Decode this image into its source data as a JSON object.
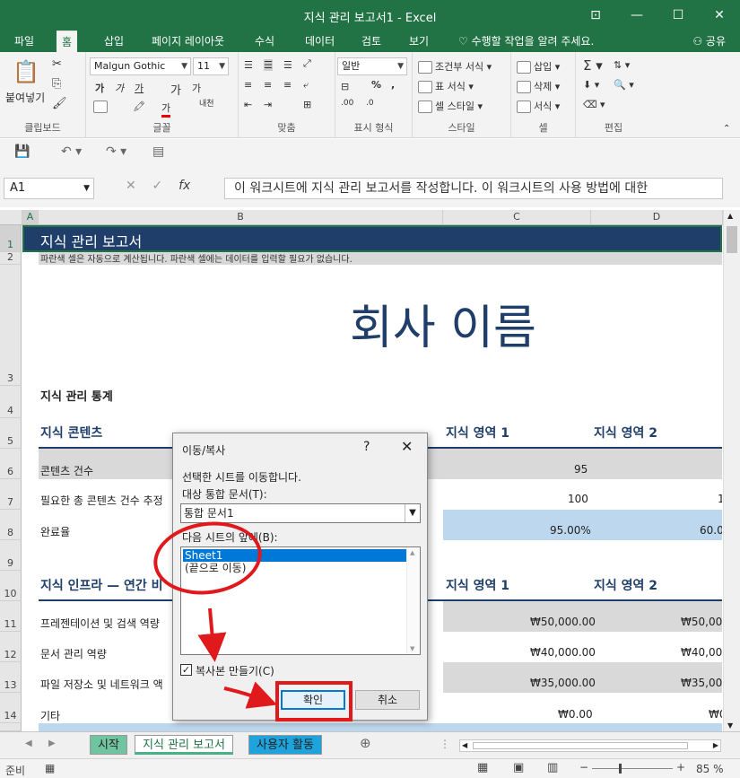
{
  "window": {
    "title": "지식 관리 보고서1 - Excel"
  },
  "ribbon_tabs": [
    "파일",
    "홈",
    "삽입",
    "페이지 레이아웃",
    "수식",
    "데이터",
    "검토",
    "보기"
  ],
  "active_tab": "홈",
  "tell_me": "수행할 작업을 알려 주세요.",
  "share_label": "공유",
  "ribbon": {
    "paste_label": "붙여넣기",
    "clipboard_label": "클립보드",
    "font_name": "Malgun Gothic",
    "font_size": "11",
    "font_label": "글꼴",
    "align_label": "맞춤",
    "number_format": "일반",
    "number_label": "표시 형식",
    "cond_format": "조건부 서식",
    "table_format": "표 서식",
    "cell_style": "셀 스타일",
    "style_label": "스타일",
    "insert": "삽입",
    "delete": "삭제",
    "format": "서식",
    "cells_label": "셀",
    "edit_label": "편집"
  },
  "formula_bar": {
    "name_box": "A1",
    "fx": "fx",
    "formula": "이 워크시트에 지식 관리 보고서를 작성합니다. 이 워크시트의 사용 방법에 대한"
  },
  "columns": [
    "A",
    "B",
    "C",
    "D"
  ],
  "rows": [
    "1",
    "2",
    "3",
    "4",
    "5",
    "6",
    "7",
    "8",
    "9",
    "10",
    "11",
    "12",
    "13",
    "14"
  ],
  "sheet": {
    "title": "지식 관리 보고서",
    "note": "파란색 셀은 자동으로 계산됩니다. 파란색 셀에는 데이터를 입력할 필요가 없습니다.",
    "company": "회사 이름",
    "stats_header": "지식 관리 통계",
    "content_header": "지식 콘텐츠",
    "area1": "지식 영역 1",
    "area2": "지식 영역 2",
    "row6_label": "콘텐츠 건수",
    "row6_c": "95",
    "row7_label": "필요한 총 콘텐츠 건수 추정",
    "row7_c": "100",
    "row7_d": "1",
    "row8_label": "완료율",
    "row8_c": "95.00%",
    "row8_d": "60.0",
    "infra_header": "지식 인프라 — 연간 비",
    "row11_label": "프레젠테이션 및 검색 역량",
    "row11_c": "₩50,000.00",
    "row11_d": "₩50,00",
    "row12_label": "문서 관리 역량",
    "row12_c": "₩40,000.00",
    "row12_d": "₩40,00",
    "row13_label": "파일 저장소 및 네트워크 액",
    "row13_c": "₩35,000.00",
    "row13_d": "₩35,00",
    "row14_label": "기타",
    "row14_c": "₩0.00",
    "row14_d": "₩0"
  },
  "sheet_tabs": [
    "시작",
    "지식 관리 보고서",
    "사용자 활동"
  ],
  "status": {
    "ready": "준비",
    "zoom": "85 %"
  },
  "dialog": {
    "title": "이동/복사",
    "help": "?",
    "close": "✕",
    "instruction": "선택한 시트를 이동합니다.",
    "target_label": "대상 통합 문서(T):",
    "target_value": "통합 문서1",
    "before_label": "다음 시트의 앞에(B):",
    "list_items": [
      "Sheet1",
      "(끝으로 이동)"
    ],
    "copy_label": "복사본 만들기(C)",
    "copy_checked": true,
    "ok": "확인",
    "cancel": "취소"
  },
  "colors": {
    "excel_green": "#217346",
    "navy": "#1f3e6a",
    "annotation_red": "#e0191c"
  }
}
